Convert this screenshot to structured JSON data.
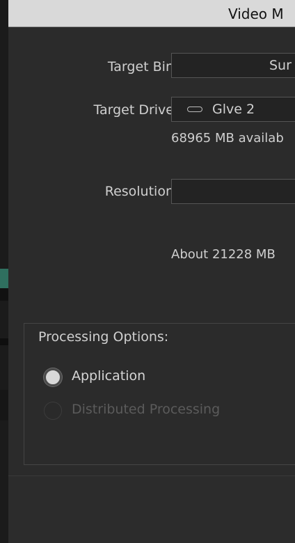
{
  "dialog": {
    "title": "Video M",
    "target_bin_label": "Target Bin",
    "target_bin_value": "Sur",
    "target_drive_label": "Target Drive",
    "target_drive_value": "Glve 2",
    "target_drive_icon": "drive-icon",
    "available_text": "68965 MB availab",
    "resolution_label": "Resolution",
    "resolution_value": "",
    "about_text": "About 21228 MB",
    "processing_title": "Processing Options:",
    "options": [
      {
        "label": "Application",
        "selected": true,
        "enabled": true
      },
      {
        "label": "Distributed Processing",
        "selected": false,
        "enabled": false
      }
    ]
  },
  "colors": {
    "background": "#2b2b2b",
    "titlebar": "#d9d9d9",
    "accent_edge": "#2f6f5f"
  }
}
